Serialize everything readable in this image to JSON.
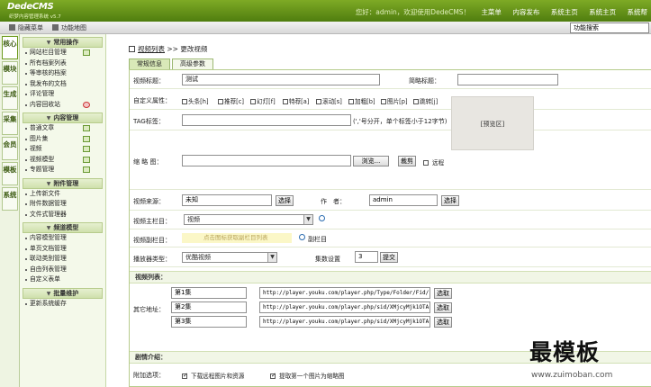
{
  "app": {
    "logo": "DedeCMS",
    "logo_sub": "织梦内容管理系统 v5.7"
  },
  "top_links": {
    "welcome": "您好：admin，欢迎使用DedeCMS！",
    "items": [
      "主菜单",
      "内容发布",
      "系统主页",
      "系统主页",
      "系统帮"
    ]
  },
  "toolbar": {
    "hide_menu": "隐藏菜单",
    "feature_map": "功能地图",
    "search_value": "功能搜索"
  },
  "left_tabs": [
    "核心",
    "模块",
    "生成",
    "采集",
    "会员",
    "模板",
    "系统"
  ],
  "sidebar": {
    "groups": [
      {
        "title": "常用操作",
        "items": [
          "网站栏目管理",
          "所有档案列表",
          "等审核的档案",
          "我发布的文档",
          "评论管理",
          "内容回收站"
        ]
      },
      {
        "title": "内容管理",
        "items": [
          "普通文章",
          "图片集",
          "视频",
          "视频模型",
          "专题管理"
        ]
      },
      {
        "title": "附件管理",
        "items": [
          "上传新文件",
          "附件数据管理",
          "文件式管理器"
        ]
      },
      {
        "title": "频道模型",
        "items": [
          "内容模型管理",
          "单页文档管理",
          "联动类别管理",
          "自由列表管理",
          "自定义表单"
        ]
      },
      {
        "title": "批量维护",
        "items": [
          "更新系统缓存"
        ]
      }
    ]
  },
  "breadcrumb": {
    "list": "视频列表",
    "sep": ">>",
    "current": "更改视频"
  },
  "tabs": {
    "basic": "常规信息",
    "advanced": "高级参数"
  },
  "form": {
    "title_label": "视频标题：",
    "title_value": "测试",
    "short_title_label": "简略标题：",
    "short_title_value": "",
    "flags_label": "自定义属性：",
    "flags": [
      "头条[h]",
      "推荐[c]",
      "幻灯[f]",
      "特荐[a]",
      "滚动[s]",
      "加粗[b]",
      "图片[p]",
      "跳转[j]"
    ],
    "tag_label": "TAG标签：",
    "tag_value": "",
    "tag_hint": "(','号分开，单个标签小于12字节)",
    "thumb_label": "缩 略 图：",
    "thumb_value": "",
    "browse_btn": "浏览...",
    "crop_btn": "裁剪",
    "remote_label": "远程",
    "preview_text": "[预览区]",
    "source_label": "视频来源：",
    "source_value": "未知",
    "source_select_btn": "选择",
    "author_label": "作　者：",
    "author_value": "admin",
    "author_select_btn": "选择",
    "column_label": "视频主栏目：",
    "column_value": "视频",
    "sub_column_label": "视频副栏目：",
    "sub_column_placeholder": "点击图标获取副栏目列表",
    "sub_column_btn": "副栏目",
    "player_label": "播放器类型：",
    "player_value": "优酷视频",
    "episodes_label": "集数设置",
    "episodes_value": "3",
    "episodes_btn": "提交",
    "video_list_header": "视频列表：",
    "episodes_row_label": "其它地址：",
    "episodes": [
      {
        "name": "第1集",
        "url": "http://player.youku.com/player.php/Type/Folder/Fid/",
        "btn": "选取"
      },
      {
        "name": "第2集",
        "url": "http://player.youku.com/player.php/sid/XMjcyMjk1OTA",
        "btn": "选取"
      },
      {
        "name": "第3集",
        "url": "http://player.youku.com/player.php/sid/XMjcyMjk1OTA",
        "btn": "选取"
      }
    ],
    "intro_header": "剧情介绍：",
    "options_label": "附加选项：",
    "opt_download": "下载远程图片和资源",
    "opt_first_image": "提取第一个图片为缩略图"
  },
  "watermark": {
    "title": "最模板",
    "url": "www.zuimoban.com"
  }
}
